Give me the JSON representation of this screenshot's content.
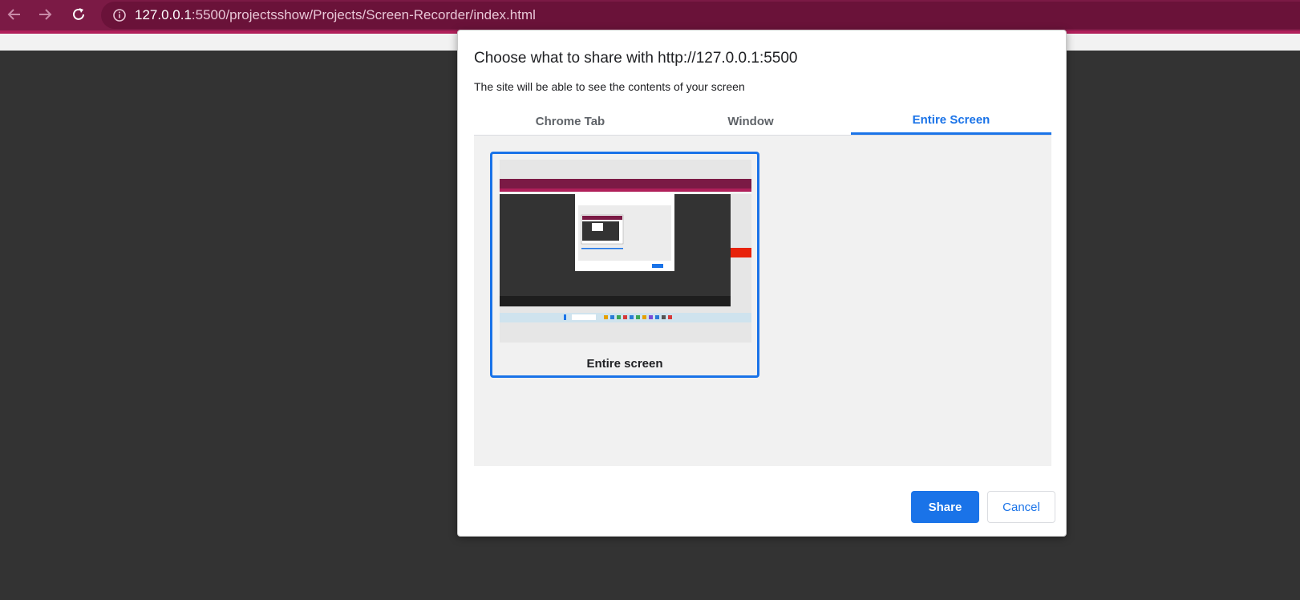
{
  "browser": {
    "url_host": "127.0.0.1",
    "url_rest": ":5500/projectsshow/Projects/Screen-Recorder/index.html",
    "icons": [
      "back-arrow-icon",
      "forward-arrow-icon",
      "reload-icon",
      "info-icon"
    ]
  },
  "dialog": {
    "title": "Choose what to share with http://127.0.0.1:5500",
    "subtitle": "The site will be able to see the contents of your screen",
    "tabs": [
      {
        "label": "Chrome Tab",
        "active": false
      },
      {
        "label": "Window",
        "active": false
      },
      {
        "label": "Entire Screen",
        "active": true
      }
    ],
    "source_card": {
      "label": "Entire screen",
      "selected": true
    },
    "share_label": "Share",
    "cancel_label": "Cancel"
  },
  "colors": {
    "toolbar": "#7b1a45",
    "accent": "#1a73e8",
    "page_background": "#333333"
  }
}
